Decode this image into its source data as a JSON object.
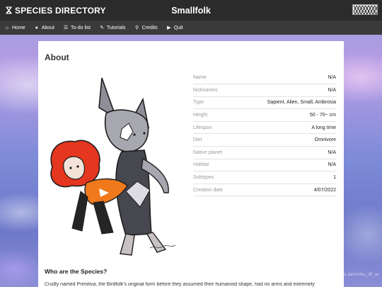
{
  "header": {
    "brand": "SPECIES DIRECTORY",
    "title": "Smallfolk"
  },
  "nav": [
    {
      "label": "Home",
      "icon": "home-icon"
    },
    {
      "label": "About",
      "icon": "info-icon"
    },
    {
      "label": "To-do list",
      "icon": "list-icon"
    },
    {
      "label": "Tutorials",
      "icon": "wand-icon"
    },
    {
      "label": "Credits",
      "icon": "search-icon"
    },
    {
      "label": "Quit",
      "icon": "play-icon"
    }
  ],
  "about": {
    "heading": "About",
    "rows": [
      {
        "key": "Name",
        "value": "N/A"
      },
      {
        "key": "Nicknames",
        "value": "N/A"
      },
      {
        "key": "Type",
        "value": "Sapient, Alien, Small, Ambrosia"
      },
      {
        "key": "Height",
        "value": "50 - 70~ cm"
      },
      {
        "key": "Lifespan",
        "value": "A long time"
      },
      {
        "key": "Diet",
        "value": "Omnivore"
      },
      {
        "key": "Native planet",
        "value": "N/A"
      },
      {
        "key": "Habitat",
        "value": "N/A"
      },
      {
        "key": "Subtypes",
        "value": "1"
      },
      {
        "key": "Creation date",
        "value": "4/07/2022"
      }
    ],
    "species_heading": "Who are the Species?",
    "description": "Crudly named Primitiva, the Birdfolk's original form before they assumed their humanoid shape, had no arms and extremely"
  },
  "watermark": "toyhou.se/miku_dl_ar",
  "colors": {
    "topbar": "#2b2b2b",
    "navbar": "#3a3a3a",
    "card": "#ffffff"
  }
}
